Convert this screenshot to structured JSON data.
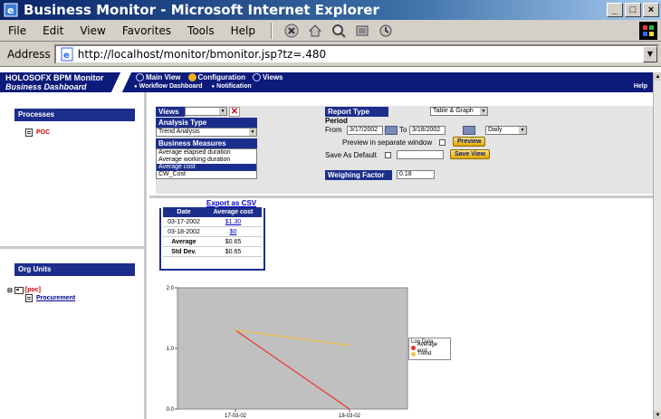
{
  "window": {
    "title": "Business Monitor - Microsoft Internet Explorer",
    "buttons": [
      "_",
      "□",
      "×"
    ]
  },
  "menu": {
    "items": [
      "File",
      "Edit",
      "View",
      "Favorites",
      "Tools",
      "Help"
    ]
  },
  "address": {
    "label": "Address",
    "url": "http://localhost/monitor/bmonitor.jsp?tz=.480"
  },
  "app": {
    "brand": "HOLOSOFX BPM Monitor",
    "subtitle": "Business Dashboard",
    "topnav": [
      "Main View",
      "Configuration",
      "Views"
    ],
    "subnav": [
      "Workflow Dashboard",
      "Notification"
    ],
    "help": "Help"
  },
  "sidebar": {
    "processes_title": "Processes",
    "process_item": "POC",
    "orgunits_title": "Org Units",
    "org_root": "[poc]",
    "org_child": "Procurement"
  },
  "form": {
    "views_label": "Views",
    "views_value": "",
    "analysis_type_label": "Analysis Type",
    "analysis_type_value": "Trend Analysis",
    "business_measures_label": "Business Measures",
    "measures": [
      "Average elapsed duration",
      "Average working duration",
      "Average cost",
      "CW_Cost"
    ],
    "selected_measure": "Average cost",
    "report_type_label": "Report Type",
    "report_type_value": "Table & Graph",
    "period_label": "Period",
    "from_label": "From",
    "from_value": "3/17/2002",
    "to_label": "To",
    "to_value": "3/18/2002",
    "interval_value": "Daily",
    "preview_window_label": "Preview in separate window",
    "preview_button": "Preview",
    "save_default_label": "Save As Default",
    "save_view_button": "Save View",
    "weighing_factor_label": "Weighing Factor",
    "weighing_factor_value": "0.18"
  },
  "stats": {
    "export_link": "Export as CSV",
    "headers": [
      "Date",
      "Average cost"
    ],
    "rows": [
      {
        "date": "03-17-2002",
        "value": "$1.30"
      },
      {
        "date": "03-18-2002",
        "value": "$0"
      }
    ],
    "average_label": "Average",
    "average_value": "$0.65",
    "stddev_label": "Std Dev.",
    "stddev_value": "$0.65"
  },
  "chart_data": {
    "type": "line",
    "x": [
      "17-03-02",
      "18-03-02"
    ],
    "ylim": [
      0,
      2
    ],
    "yticks": [
      "2.0",
      "1.0",
      "0.0"
    ],
    "series": [
      {
        "name": "Average cost",
        "values": [
          1.3,
          0
        ],
        "color": "#ee3333"
      },
      {
        "name": "Trend",
        "values": [
          1.3,
          1.05
        ],
        "color": "#f2c24a"
      }
    ],
    "legend_title": "Log Data",
    "legend_position": "right"
  },
  "colors": {
    "navy": "#0c1a7a",
    "panel_blue": "#1c2e8c",
    "gold": "#e0a800"
  }
}
